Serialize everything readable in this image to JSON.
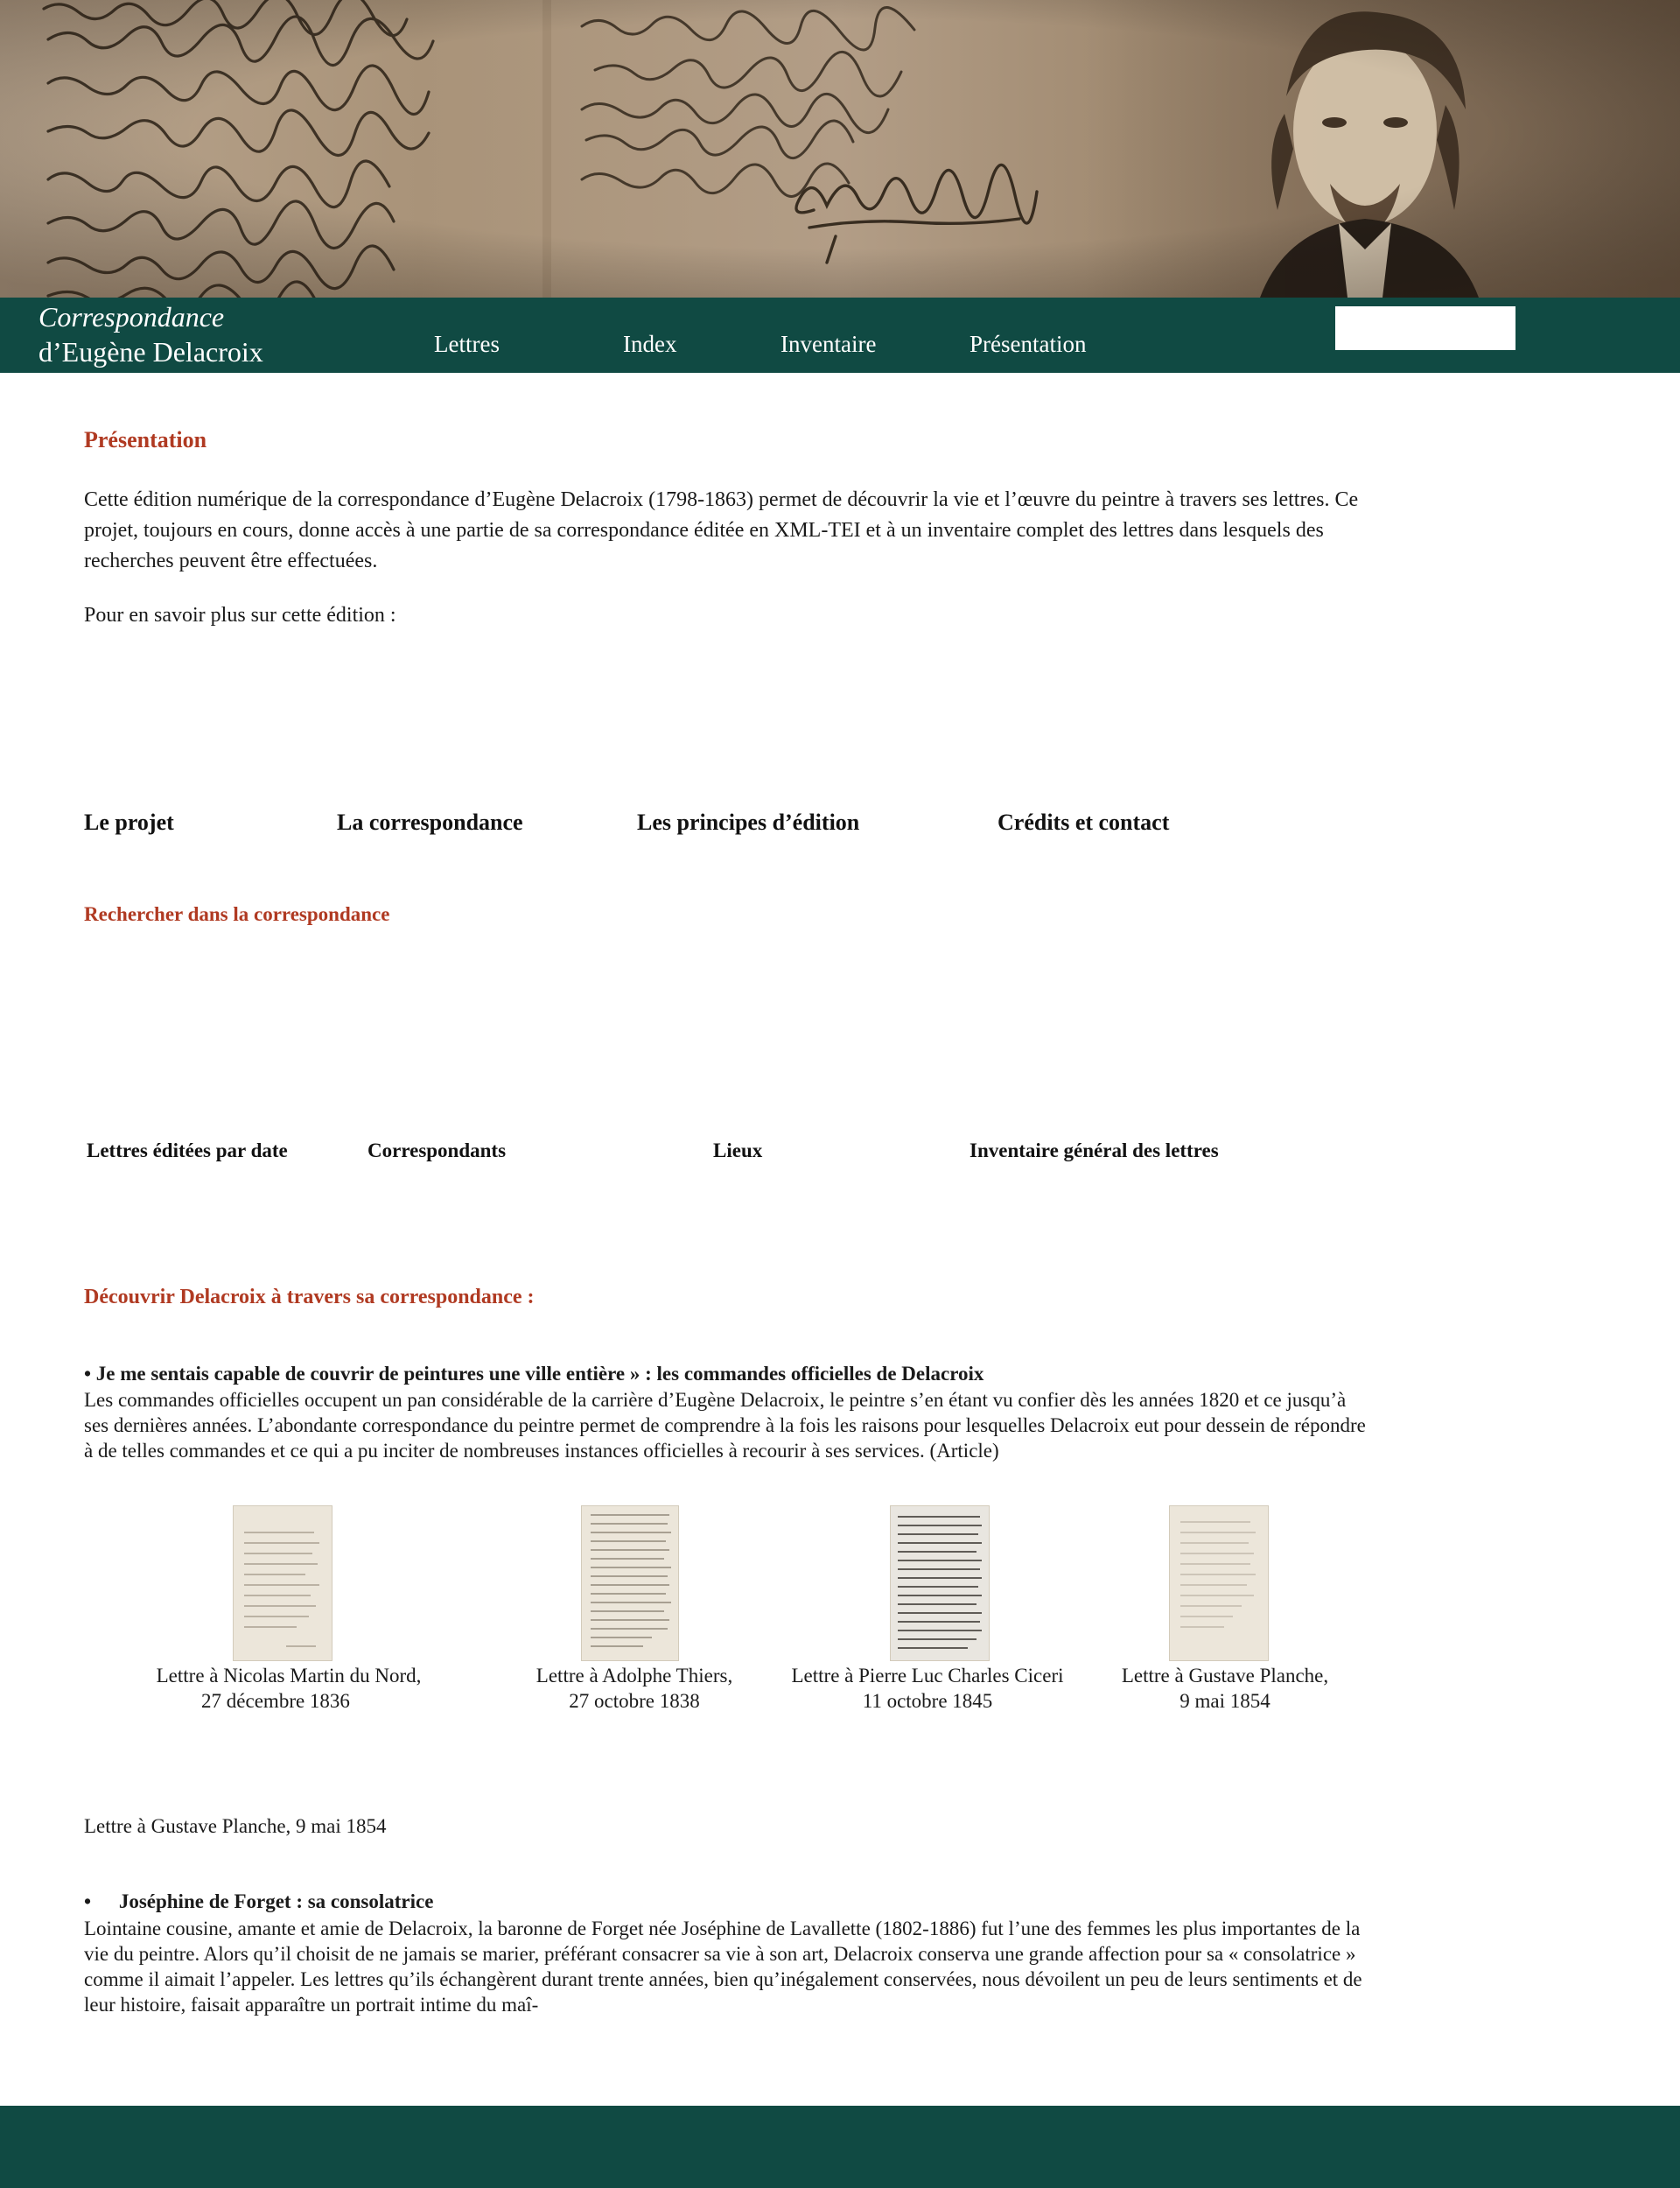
{
  "site": {
    "title_line1": "Correspondance",
    "title_line2": "d’Eugène Delacroix"
  },
  "nav": {
    "items": [
      "Lettres",
      "Index",
      "Inventaire",
      "Présentation"
    ],
    "search_placeholder": ""
  },
  "presentation": {
    "heading": "Présentation",
    "intro": "Cette édition numérique de la correspondance d’Eugène Delacroix (1798-1863) permet de découvrir la vie et l’œuvre du peintre à travers ses lettres. Ce projet, toujours en cours, donne accès à une partie de sa correspondance éditée en XML-TEI et à un inventaire complet des lettres dans lesquels des recherches peuvent être effectuées.",
    "more": "Pour en savoir plus sur cette édition :",
    "links": [
      "Le projet",
      "La correspondance",
      "Les principes d’édition",
      "Crédits et contact"
    ]
  },
  "search_section": {
    "heading": "Rechercher dans la correspondance",
    "links": [
      "Lettres éditées par date",
      "Correspondants",
      "Lieux",
      "Inventaire général des lettres"
    ]
  },
  "discover": {
    "heading": "Découvrir Delacroix à travers sa correspondance :",
    "article1": {
      "title": "• Je me sentais capable de couvrir de peintures une ville entière » : les commandes officielles de Delacroix",
      "body": "Les commandes officielles occupent un pan considérable de la carrière d’Eugène Delacroix, le peintre s’en étant vu confier dès les années 1820 et ce jusqu’à ses dernières années. L’abondante correspondance du peintre permet de comprendre à la fois les raisons pour lesquelles Delacroix eut pour dessein de répondre à de telles commandes et ce qui a pu inciter de nombreuses instances officielles à recourir à ses services. (Article)"
    },
    "letters": [
      {
        "line1": "Lettre à Nicolas Martin du Nord,",
        "line2": "27 décembre 1836"
      },
      {
        "line1": "Lettre à Adolphe Thiers,",
        "line2": "27 octobre 1838"
      },
      {
        "line1": "Lettre à Pierre Luc Charles Ciceri",
        "line2": "11 octobre 1845"
      },
      {
        "line1": "Lettre à Gustave Planche,",
        "line2": "9 mai 1854"
      }
    ],
    "standalone_caption": "Lettre à Gustave Planche, 9 mai 1854",
    "article2": {
      "bullet": "•",
      "title": "Joséphine de Forget : sa consolatrice",
      "body": "Lointaine cousine, amante et amie de Delacroix, la baronne de Forget née Joséphine de Lavallette (1802-1886) fut l’une des femmes les plus importantes de la vie du peintre. Alors qu’il choisit de ne jamais se marier, préférant consacrer sa vie à son art, Delacroix conserva une grande affection pour sa « consolatrice » comme il aimait l’appeler. Les lettres qu’ils échangèrent durant trente années, bien qu’inégalement conservées, nous dévoilent un peu de leurs sentiments et de leur histoire, faisait apparaître un portrait intime du maî-"
    }
  },
  "colors": {
    "accent_green": "#104a43",
    "heading_red": "#b03a22",
    "banner_sepia": "#a99379"
  },
  "icons": {
    "banner": "handwritten-letter-and-portrait-image",
    "thumbnails": "letter-manuscript-thumbnail"
  }
}
